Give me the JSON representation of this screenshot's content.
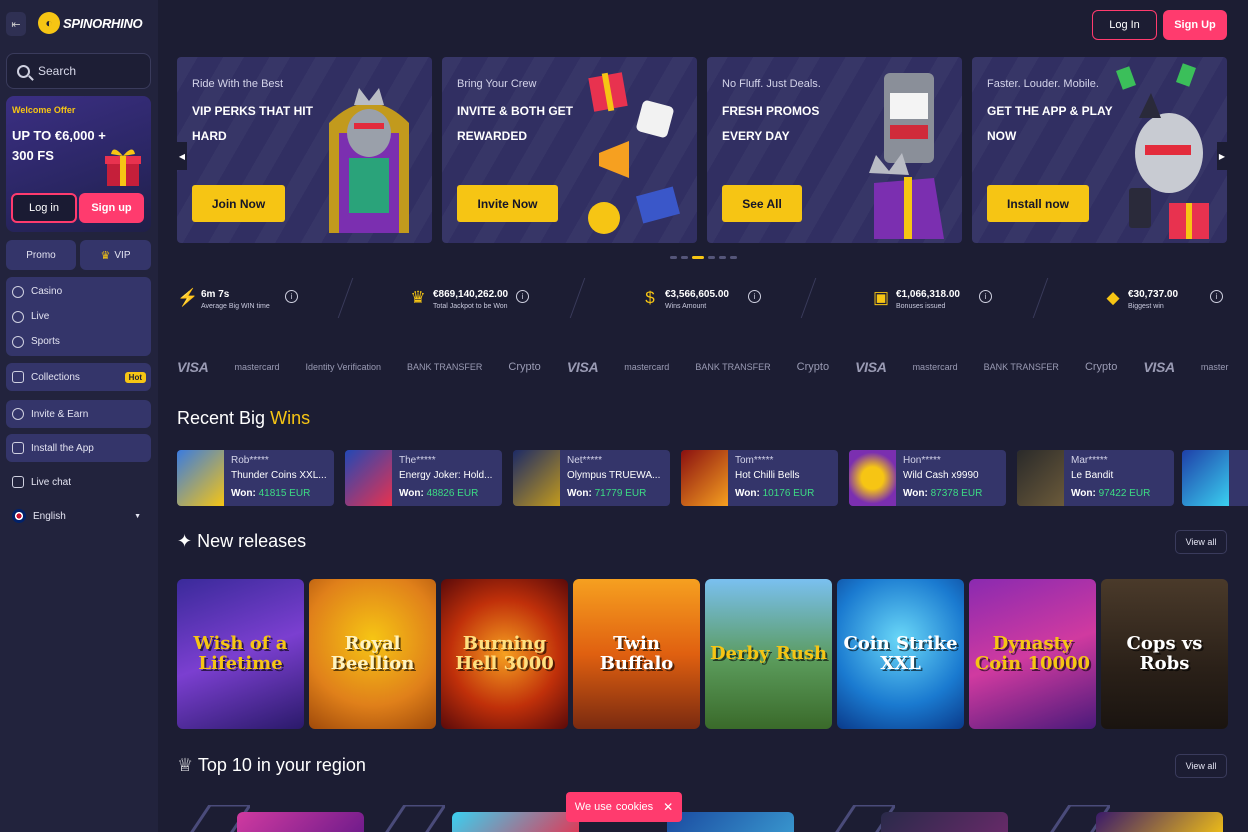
{
  "brand": {
    "name": "SPINORHINO"
  },
  "header": {
    "login_label": "Log In",
    "signup_label": "Sign Up"
  },
  "sidebar": {
    "search_placeholder": "Search",
    "offer": {
      "tag": "Welcome Offer",
      "title": "UP TO €6,000 + 300 FS",
      "login_label": "Log in",
      "signup_label": "Sign up"
    },
    "promo_label": "Promo",
    "vip_label": "VIP",
    "nav": [
      "Casino",
      "Live",
      "Sports"
    ],
    "collections_label": "Collections",
    "hot_badge": "Hot",
    "invite_label": "Invite & Earn",
    "install_label": "Install the App",
    "livechat_label": "Live chat",
    "language_label": "English"
  },
  "banners": [
    {
      "sub": "Ride With the Best",
      "title": "VIP PERKS THAT HIT HARD",
      "button": "Join Now"
    },
    {
      "sub": "Bring Your Crew",
      "title": "INVITE & BOTH GET REWARDED",
      "button": "Invite Now"
    },
    {
      "sub": "No Fluff. Just Deals.",
      "title": "FRESH PROMOS EVERY DAY",
      "button": "See All"
    },
    {
      "sub": "Faster. Louder. Mobile.",
      "title": "GET THE APP & PLAY NOW",
      "button": "Install now"
    }
  ],
  "stats": [
    {
      "value": "6m 7s",
      "label": "Average Big WIN time",
      "icon": "lightning-icon"
    },
    {
      "value": "€869,140,262.00",
      "label": "Total Jackpot to be Won",
      "icon": "crown-icon"
    },
    {
      "value": "€3,566,605.00",
      "label": "Wins Amount",
      "icon": "money-bag-icon"
    },
    {
      "value": "€1,066,318.00",
      "label": "Bonuses issued",
      "icon": "gift-icon"
    },
    {
      "value": "€30,737.00",
      "label": "Biggest win",
      "icon": "diamond-icon"
    }
  ],
  "payments": [
    "VISA",
    "mastercard",
    "Identity Verification",
    "BANK TRANSFER",
    "Crypto",
    "VISA",
    "mastercard",
    "BANK TRANSFER",
    "Crypto",
    "VISA",
    "mastercard",
    "BANK TRANSFER",
    "Crypto",
    "VISA",
    "master"
  ],
  "recent_wins": {
    "heading_main": "Recent Big",
    "heading_highlight": "Wins",
    "won_label": "Won:",
    "items": [
      {
        "user": "Rob*****",
        "game": "Thunder Coins XXL...",
        "amount": "41815 EUR"
      },
      {
        "user": "The*****",
        "game": "Energy Joker: Hold...",
        "amount": "48826 EUR"
      },
      {
        "user": "Net*****",
        "game": "Olympus TRUEWA...",
        "amount": "71779 EUR"
      },
      {
        "user": "Tom*****",
        "game": "Hot Chilli Bells",
        "amount": "10176 EUR"
      },
      {
        "user": "Hon*****",
        "game": "Wild Cash x9990",
        "amount": "87378 EUR"
      },
      {
        "user": "Mar*****",
        "game": "Le Bandit",
        "amount": "97422 EUR"
      },
      {
        "user": "",
        "game": "",
        "amount": ""
      }
    ]
  },
  "new_releases": {
    "heading": "New releases",
    "view_all": "View all",
    "games": [
      "Wish of a Lifetime",
      "Royal Beellion",
      "Burning Hell 3000",
      "Twin Buffalo",
      "Derby Rush",
      "Coin Strike XXL",
      "Dynasty Coin 10000",
      "Cops vs Robs"
    ]
  },
  "top10": {
    "heading": "Top 10 in your region",
    "view_all": "View all"
  },
  "cookie": {
    "text": "We use",
    "highlight": "cookies"
  }
}
